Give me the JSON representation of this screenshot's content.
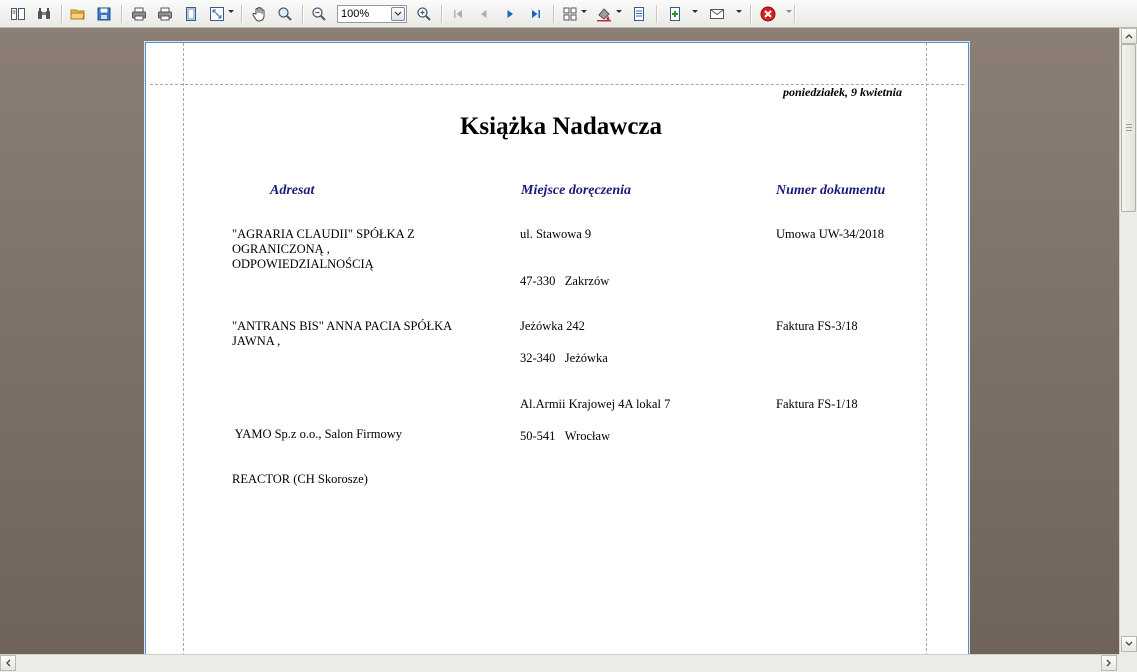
{
  "toolbar": {
    "zoom": {
      "value": "100%"
    }
  },
  "report": {
    "date": "poniedziałek, 9 kwietnia",
    "title": "Książka Nadawcza",
    "columns": {
      "addressee": "Adresat",
      "place": "Miejsce doręczenia",
      "document": "Numer dokumentu"
    },
    "rows": [
      {
        "name_lines": [
          "\"AGRARIA CLAUDII\" SPÓŁKA Z",
          "OGRANICZONĄ ,",
          "ODPOWIEDZIALNOŚCIĄ"
        ],
        "street": "ul. Stawowa 9",
        "postal": "47-330",
        "city": "Zakrzów",
        "document": "Umowa UW-34/2018"
      },
      {
        "name_lines": [
          "\"ANTRANS BIS\" ANNA PACIA SPÓŁKA",
          "JAWNA ,"
        ],
        "street": "Jeżówka 242",
        "postal": "32-340",
        "city": "Jeżówka",
        "document": "Faktura FS-3/18"
      },
      {
        "name_lines": [
          " YAMO Sp.z o.o., Salon Firmowy",
          "REACTOR (CH Skorosze)"
        ],
        "street": "Al.Armii Krajowej 4A lokal 7",
        "postal": "50-541",
        "city": "Wrocław",
        "document": "Faktura FS-1/18"
      }
    ]
  }
}
